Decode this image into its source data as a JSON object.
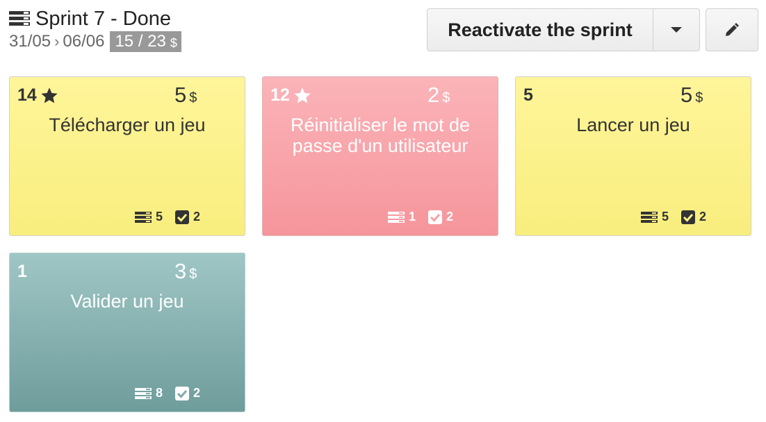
{
  "header": {
    "title": "Sprint 7 - Done",
    "start_date": "31/05",
    "separator": "›",
    "end_date": "06/06",
    "points": "15 / 23",
    "points_currency": "$"
  },
  "actions": {
    "reactivate_label": "Reactivate the sprint",
    "dropdown_icon": "caret-down-icon",
    "edit_icon": "pencil-icon"
  },
  "colors": {
    "yellow": "#f8ee7e",
    "red": "#f5959b",
    "teal": "#6f9d9c"
  },
  "cards": [
    {
      "id": "14",
      "starred": true,
      "points": "5",
      "currency": "$",
      "title": "Télécharger un jeu",
      "tasks": "5",
      "checks": "2",
      "color": "yellow"
    },
    {
      "id": "12",
      "starred": true,
      "points": "2",
      "currency": "$",
      "title": "Réinitialiser le mot de passe d'un utilisateur",
      "tasks": "1",
      "checks": "2",
      "color": "red"
    },
    {
      "id": "5",
      "starred": false,
      "points": "5",
      "currency": "$",
      "title": "Lancer un jeu",
      "tasks": "5",
      "checks": "2",
      "color": "yellow"
    },
    {
      "id": "1",
      "starred": false,
      "points": "3",
      "currency": "$",
      "title": "Valider un jeu",
      "tasks": "8",
      "checks": "2",
      "color": "teal"
    }
  ]
}
